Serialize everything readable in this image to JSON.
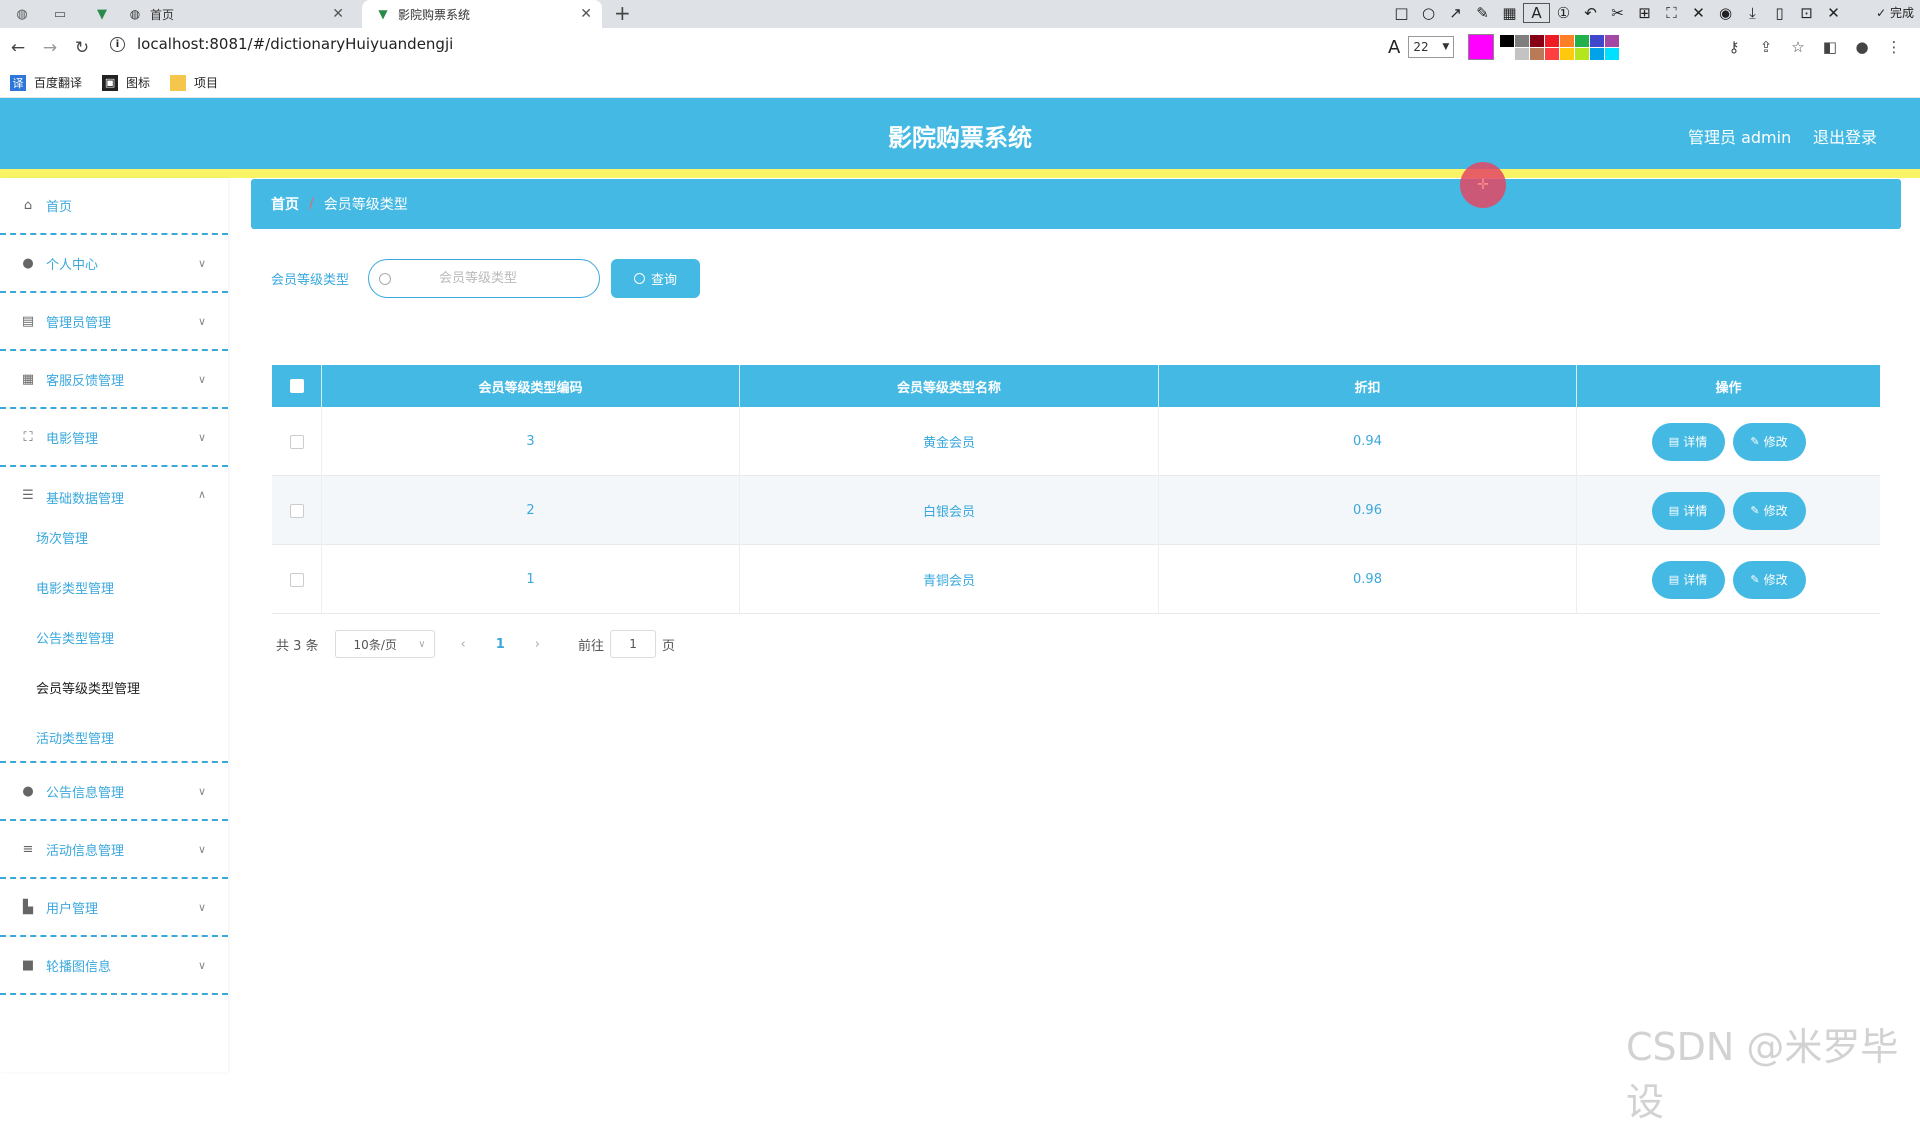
{
  "browser": {
    "tabs": [
      {
        "label": "首页"
      },
      {
        "label": "影院购票系统"
      }
    ],
    "url": "localhost:8081/#/dictionaryHuiyuandengji",
    "bookmarks": [
      {
        "label": "百度翻译"
      },
      {
        "label": "图标"
      },
      {
        "label": "项目"
      }
    ],
    "annotation": {
      "done_label": "完成",
      "font_size": "22",
      "current_color": "#ff00ff",
      "palette": [
        "#000000",
        "#7f7f7f",
        "#880015",
        "#ed1c24",
        "#ff7f27",
        "#22b14c",
        "#3f48cc",
        "#a349a4",
        "#ffffff",
        "#c3c3c3",
        "#b97a57",
        "#ff4040",
        "#ffc90e",
        "#b5e61d",
        "#00a2e8",
        "#00e0ff"
      ]
    }
  },
  "header": {
    "title": "影院购票系统",
    "user_label": "管理员 admin",
    "logout_label": "退出登录"
  },
  "sidebar": {
    "menu": [
      {
        "label": "首页",
        "icon": "home-icon"
      },
      {
        "label": "个人中心",
        "icon": "user-icon"
      },
      {
        "label": "管理员管理",
        "icon": "clipboard-icon"
      },
      {
        "label": "客服反馈管理",
        "icon": "grid-icon"
      },
      {
        "label": "电影管理",
        "icon": "fullscreen-icon"
      },
      {
        "label": "基础数据管理",
        "icon": "sliders-icon"
      },
      {
        "label": "公告信息管理",
        "icon": "user-icon"
      },
      {
        "label": "活动信息管理",
        "icon": "list-icon"
      },
      {
        "label": "用户管理",
        "icon": "thumb-icon"
      },
      {
        "label": "轮播图信息",
        "icon": "camera-icon"
      }
    ],
    "submenu": [
      {
        "label": "场次管理"
      },
      {
        "label": "电影类型管理"
      },
      {
        "label": "公告类型管理"
      },
      {
        "label": "会员等级类型管理"
      },
      {
        "label": "活动类型管理"
      }
    ]
  },
  "breadcrumb": {
    "home": "首页",
    "separator": "/",
    "current": "会员等级类型"
  },
  "search": {
    "label": "会员等级类型",
    "placeholder": "会员等级类型",
    "button_label": "查询"
  },
  "table": {
    "columns": [
      "会员等级类型编码",
      "会员等级类型名称",
      "折扣",
      "操作"
    ],
    "detail_label": "详情",
    "edit_label": "修改",
    "rows": [
      {
        "code": "3",
        "name": "黄金会员",
        "discount": "0.94"
      },
      {
        "code": "2",
        "name": "白银会员",
        "discount": "0.96"
      },
      {
        "code": "1",
        "name": "青铜会员",
        "discount": "0.98"
      }
    ]
  },
  "pagination": {
    "total": "共 3 条",
    "page_size": "10条/页",
    "current_page": "1",
    "goto_prefix": "前往",
    "goto_value": "1",
    "goto_suffix": "页"
  },
  "watermark": "CSDN @米罗毕设"
}
